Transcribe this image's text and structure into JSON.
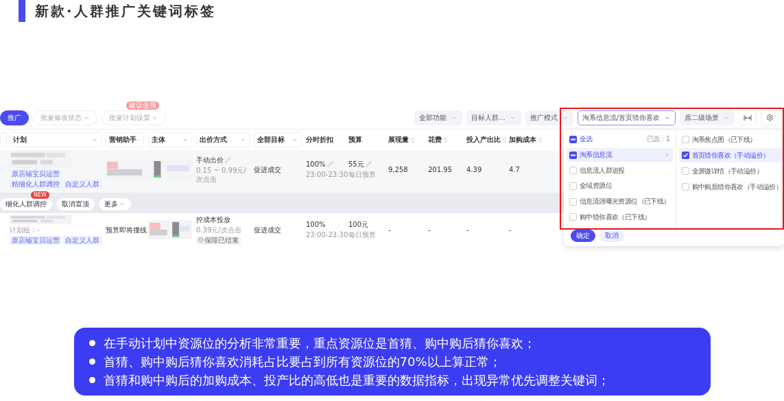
{
  "slide": {
    "title": "新款·人群推广关键词标签"
  },
  "toolbar": {
    "left_buttons": [
      {
        "label": "推广",
        "kind": "primary"
      },
      {
        "label": "批量修改状态",
        "kind": "menu"
      },
      {
        "label": "批量计划设置",
        "kind": "menu",
        "badge": "建议使用"
      }
    ],
    "filters": [
      {
        "label": "全部功能"
      },
      {
        "label": "目标人群..."
      },
      {
        "label": "推广模式"
      }
    ],
    "scene_select": {
      "value": "淘系信息流/首页猜你喜欢",
      "expanded": true
    },
    "secondary_select": {
      "label": "原二级场景"
    }
  },
  "table": {
    "columns": [
      {
        "kind": "select"
      },
      {
        "label": "计划",
        "kind": "select"
      },
      {
        "label": "营销助手",
        "kind": "select"
      },
      {
        "label": "主体",
        "kind": "select"
      },
      {
        "label": "出价方式",
        "kind": "select"
      },
      {
        "label": "全部目标",
        "kind": "select"
      },
      {
        "label": "分时折扣",
        "kind": "plain"
      },
      {
        "label": "预算",
        "kind": "plain"
      },
      {
        "label": "展现量",
        "kind": "sort"
      },
      {
        "label": "花费",
        "kind": "sort"
      },
      {
        "label": "投入产出比",
        "kind": "sort"
      },
      {
        "label": "加购成本",
        "kind": "sort"
      }
    ],
    "rows": [
      {
        "highlighted": true,
        "plan": {
          "tags": [
            "原店铺宝贝运营",
            "精细化人群调控",
            "自定义人群"
          ]
        },
        "bid": {
          "mode": "手动出价",
          "editable": true,
          "price": "0.15 ~ 0.99元/次点击"
        },
        "goal": "促进成交",
        "discount": {
          "value": "100%",
          "editable": true,
          "time": "23:00-23:30"
        },
        "budget": {
          "value": "55元",
          "editable": true,
          "note": "每日预算"
        },
        "impressions": "9,258",
        "spend": "201.95",
        "roi": "4.39",
        "cart_cost": "4.7",
        "actions": [
          {
            "label": "细化人群调控",
            "badge": "NEW",
            "kind": "plain"
          },
          {
            "label": "取消置顶",
            "kind": "plain"
          },
          {
            "label": "更多",
            "kind": "menu"
          }
        ]
      },
      {
        "highlighted": false,
        "plan": {
          "group": "计划组：-",
          "tags": [
            "原店铺宝贝运营",
            "自定义人群"
          ]
        },
        "assistant": "预算即将撞线",
        "bid": {
          "mode": "控成本投放",
          "editable": false,
          "price": "0.39元/次点击",
          "badge": "保障已结束"
        },
        "goal": "促进成交",
        "discount": {
          "value": "100%",
          "editable": false,
          "time": "23:00-23:30"
        },
        "budget": {
          "value": "100元",
          "editable": false,
          "note": "每日预算"
        },
        "impressions": "-",
        "spend": "-",
        "roi": "-",
        "cart_cost": "-"
      }
    ]
  },
  "dropdown": {
    "select_all": {
      "label": "全选",
      "checked": false,
      "indeterminate": true
    },
    "count": "已选：1",
    "groups": [
      {
        "label": "淘系信息流",
        "checked": false,
        "indeterminate": true,
        "selected": true,
        "has_children": true
      },
      {
        "label": "信息流人群追投",
        "checked": false,
        "indeterminate": false,
        "selected": false,
        "has_children": false
      },
      {
        "label": "全域资源位",
        "checked": false,
        "indeterminate": false,
        "selected": false,
        "has_children": false
      },
      {
        "label": "信息流强曝光资源位（已下线）",
        "checked": false,
        "indeterminate": false,
        "selected": false,
        "has_children": false
      },
      {
        "label": "购中猜你喜欢（已下线）",
        "checked": false,
        "indeterminate": false,
        "selected": false,
        "has_children": false
      }
    ],
    "children": [
      {
        "label": "淘系焦点图（已下线）",
        "checked": false,
        "selected": false
      },
      {
        "label": "首页猜你喜欢（手动溢价）",
        "checked": true,
        "selected": true
      },
      {
        "label": "全屏微详情（手动溢价）",
        "checked": false,
        "selected": false
      },
      {
        "label": "购中购后猜你喜欢（手动溢价）",
        "checked": false,
        "selected": false
      }
    ],
    "buttons": [
      {
        "label": "确定",
        "kind": "primary"
      },
      {
        "label": "取消",
        "kind": "secondary"
      }
    ]
  },
  "callout": {
    "bullets": [
      "在手动计划中资源位的分析非常重要，重点资源位是首猜、购中购后猜你喜欢；",
      "首猜、购中购后猜你喜欢消耗占比要占到所有资源位的70%以上算正常；",
      "首猜和购中购后的加购成本、投产比的高低也是重要的数据指标，出现异常优先调整关键词；"
    ]
  }
}
